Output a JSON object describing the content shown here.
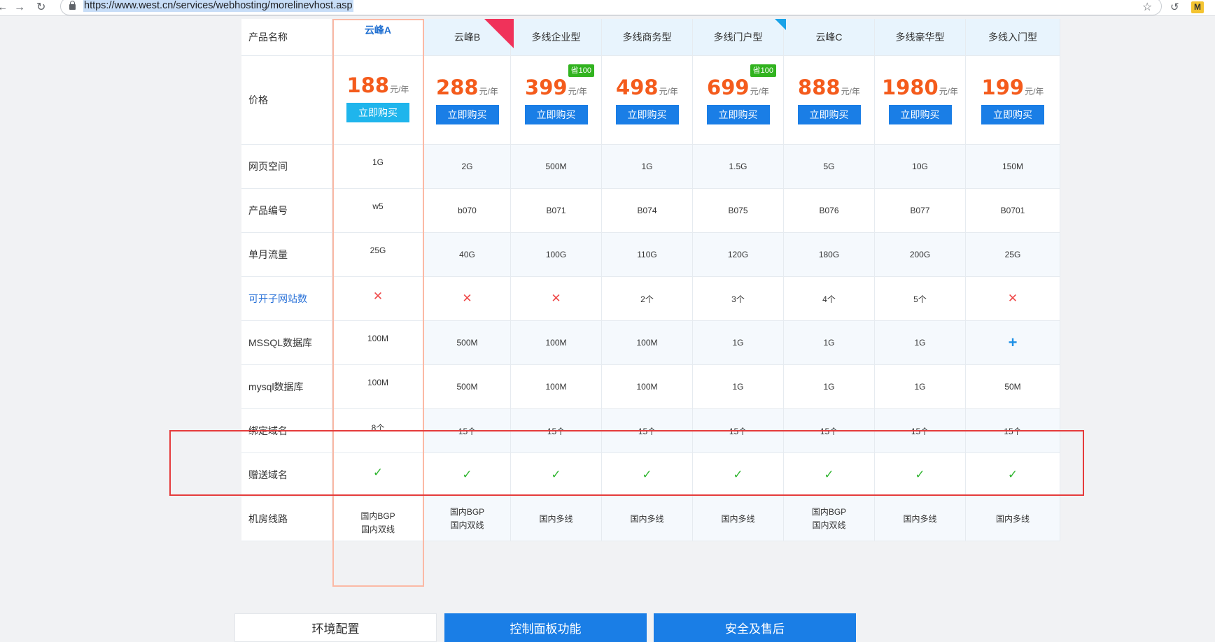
{
  "browser": {
    "url": "https://www.west.cn/services/webhosting/morelinevhost.asp",
    "ext_label": "M"
  },
  "table": {
    "row_labels": [
      "产品名称",
      "价格",
      "网页空间",
      "产品编号",
      "单月流量",
      "可开子网站数",
      "MSSQL数据库",
      "mysql数据库",
      "绑定域名",
      "赠送域名",
      "机房线路"
    ],
    "products": [
      {
        "name": "云峰A",
        "price": "188",
        "unit": "元/年",
        "buy": "立即购买",
        "space": "1G",
        "code": "w5",
        "traffic": "25G",
        "subsites": "x",
        "mssql": "100M",
        "mysql": "100M",
        "domains": "8个",
        "gift": "check",
        "route": [
          "国内BGP",
          "国内双线"
        ]
      },
      {
        "name": "云峰B",
        "price": "288",
        "unit": "元/年",
        "buy": "立即购买",
        "space": "2G",
        "code": "b070",
        "traffic": "40G",
        "subsites": "x",
        "mssql": "500M",
        "mysql": "500M",
        "domains": "15个",
        "gift": "check",
        "route": [
          "国内BGP",
          "国内双线"
        ]
      },
      {
        "name": "多线企业型",
        "price": "399",
        "unit": "元/年",
        "buy": "立即购买",
        "save": "省100",
        "space": "500M",
        "code": "B071",
        "traffic": "100G",
        "subsites": "x",
        "mssql": "100M",
        "mysql": "100M",
        "domains": "15个",
        "gift": "check",
        "route": [
          "国内多线"
        ]
      },
      {
        "name": "多线商务型",
        "price": "498",
        "unit": "元/年",
        "buy": "立即购买",
        "space": "1G",
        "code": "B074",
        "traffic": "110G",
        "subsites": "2个",
        "mssql": "100M",
        "mysql": "100M",
        "domains": "15个",
        "gift": "check",
        "route": [
          "国内多线"
        ]
      },
      {
        "name": "多线门户型",
        "price": "699",
        "unit": "元/年",
        "buy": "立即购买",
        "save": "省100",
        "space": "1.5G",
        "code": "B075",
        "traffic": "120G",
        "subsites": "3个",
        "mssql": "1G",
        "mysql": "1G",
        "domains": "15个",
        "gift": "check",
        "route": [
          "国内多线"
        ]
      },
      {
        "name": "云峰C",
        "price": "888",
        "unit": "元/年",
        "buy": "立即购买",
        "space": "5G",
        "code": "B076",
        "traffic": "180G",
        "subsites": "4个",
        "mssql": "1G",
        "mysql": "1G",
        "domains": "15个",
        "gift": "check",
        "route": [
          "国内BGP",
          "国内双线"
        ]
      },
      {
        "name": "多线豪华型",
        "price": "1980",
        "unit": "元/年",
        "buy": "立即购买",
        "space": "10G",
        "code": "B077",
        "traffic": "200G",
        "subsites": "5个",
        "mssql": "1G",
        "mysql": "1G",
        "domains": "15个",
        "gift": "check",
        "route": [
          "国内多线"
        ]
      },
      {
        "name": "多线入门型",
        "price": "199",
        "unit": "元/年",
        "buy": "立即购买",
        "space": "150M",
        "code": "B0701",
        "traffic": "25G",
        "subsites": "x",
        "mssql": "plus",
        "mysql": "50M",
        "domains": "15个",
        "gift": "check",
        "route": [
          "国内多线"
        ]
      }
    ]
  },
  "tabs": [
    "环境配置",
    "控制面板功能",
    "安全及售后"
  ]
}
